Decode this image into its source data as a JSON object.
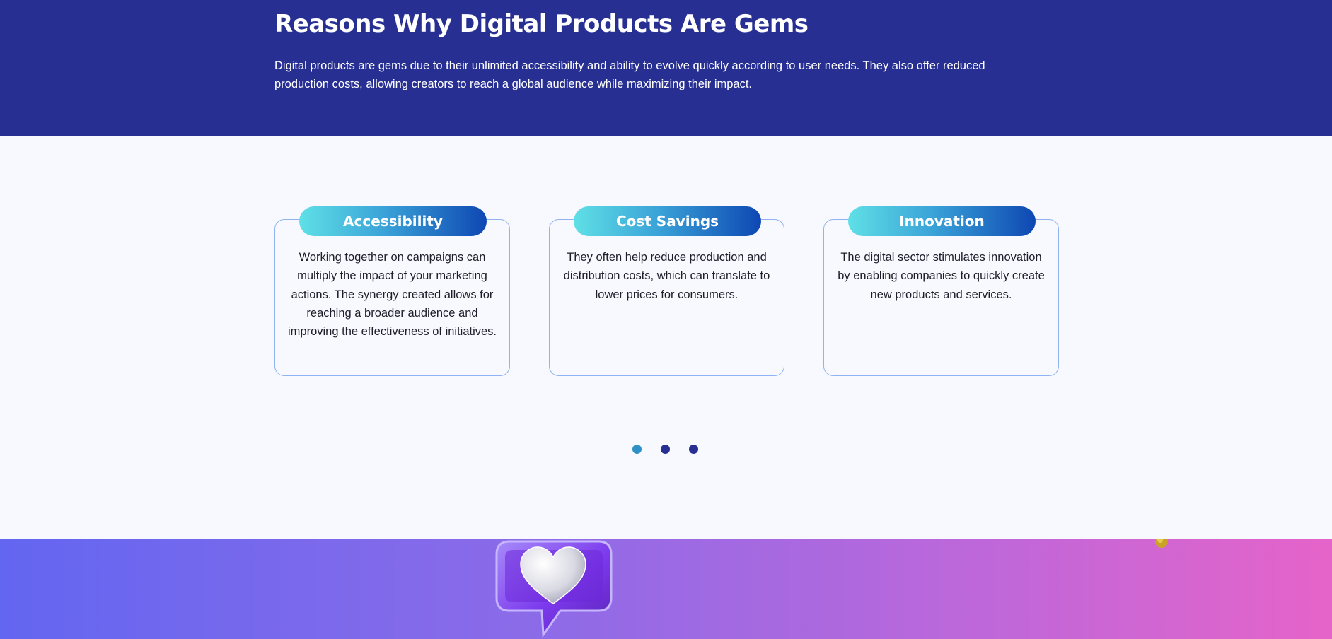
{
  "hero": {
    "title": "Reasons Why Digital Products Are Gems",
    "text": "Digital products are gems due to their unlimited accessibility and ability to evolve quickly according to user needs. They also offer reduced production costs, allowing creators to reach a global audience while maximizing their impact."
  },
  "cards": [
    {
      "title": "Accessibility",
      "text": "Working together on campaigns can multiply the impact of your marketing actions. The synergy created allows for reaching a broader audience and improving the effectiveness of initiatives."
    },
    {
      "title": "Cost Savings",
      "text": "They often help reduce production and distribution costs, which can translate to lower prices for consumers."
    },
    {
      "title": "Innovation",
      "text": "The digital sector stimulates innovation by enabling companies to quickly create new products and services."
    }
  ],
  "carousel": {
    "active_index": 0,
    "count": 3
  },
  "colors": {
    "hero_bg": "#272f93",
    "section_bg": "#f7f9fe",
    "card_border": "#8fb2f0",
    "dot": "#272f93",
    "dot_active": "#2f8fc7",
    "footer_gradient_start": "#6366f1",
    "footer_gradient_end": "#e564c9"
  },
  "icons": {
    "heart_badge": "heart-speech-bubble-icon",
    "coin": "coin-icon"
  }
}
